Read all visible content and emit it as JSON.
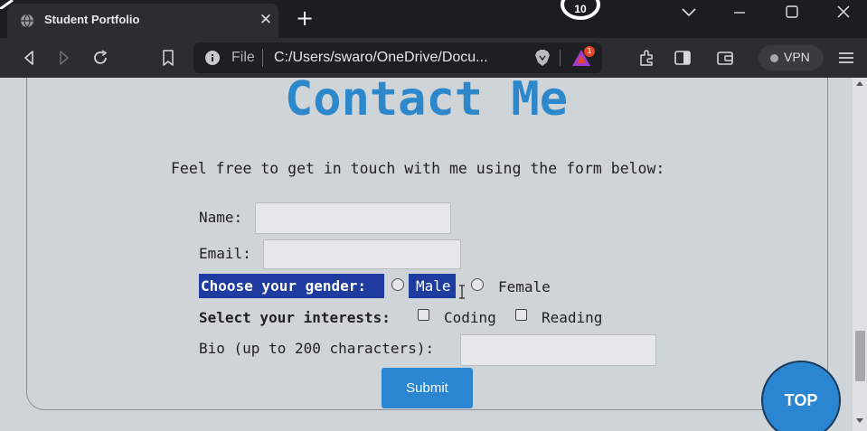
{
  "browser": {
    "tab_title": "Student Portfolio",
    "close_glyph": "✕",
    "new_tab_glyph": "+",
    "badge_count": "10",
    "url_scheme_label": "File",
    "url": "C:/Users/swaro/OneDrive/Docu...",
    "rewards_count": "1",
    "vpn_label": "VPN",
    "icons": [
      "globe-icon",
      "back-icon",
      "forward-icon",
      "reload-icon",
      "bookmark-icon",
      "info-icon",
      "brave-shield-icon",
      "brave-rewards-icon",
      "extensions-icon",
      "sidebar-icon",
      "wallet-icon",
      "menu-icon",
      "minimize-icon",
      "maximize-icon",
      "close-window-icon",
      "tab-search-icon"
    ]
  },
  "page": {
    "heading": "Contact Me",
    "intro": "Feel free to get in touch with me using the form below:",
    "form": {
      "name_label": "Name:",
      "name_value": "",
      "email_label": "Email:",
      "email_value": "",
      "gender_label": "Choose your gender:",
      "gender_options": [
        "Male",
        "Female"
      ],
      "interests_label": "Select your interests:",
      "interest_options": [
        "Coding",
        "Reading"
      ],
      "bio_label": "Bio (up to 200 characters):",
      "bio_value": "",
      "submit_label": "Submit"
    },
    "top_button": "TOP"
  },
  "colors": {
    "accent": "#2d88cb",
    "button": "#2a86d1",
    "selection": "#1e3ba0",
    "page_bg": "#cfd4d8",
    "chrome_dark": "#1c1d21"
  }
}
